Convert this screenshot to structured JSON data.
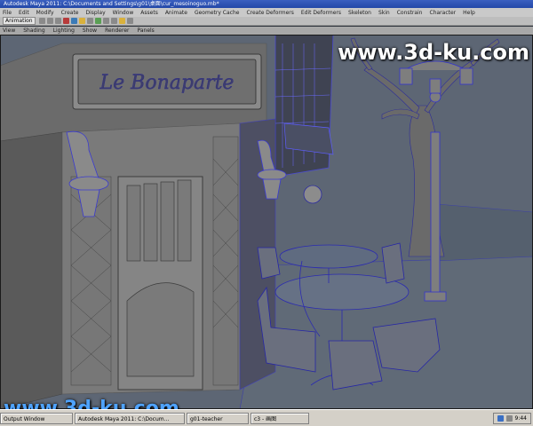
{
  "window": {
    "title": "Autodesk Maya 2011: C:\\Documents and Settings\\g01\\桌面\\cur_mesoinoguo.mb*"
  },
  "menu": [
    "File",
    "Edit",
    "Modify",
    "Create",
    "Display",
    "Window",
    "Assets",
    "Animate",
    "Geometry Cache",
    "Create Deformers",
    "Edit Deformers",
    "Skeleton",
    "Skin",
    "Constrain",
    "Character",
    "Help"
  ],
  "toolbar": {
    "mode": "Animation"
  },
  "panel_menu": [
    "View",
    "Shading",
    "Lighting",
    "Show",
    "Renderer",
    "Panels"
  ],
  "scene": {
    "sign_text": "Le Bonaparte"
  },
  "watermark": {
    "top": "www.3d-ku.com",
    "bottom": "www.3d-ku.com"
  },
  "taskbar": {
    "tasks": [
      "Output Window",
      "Autodesk Maya 2011: C:\\Docum...",
      "g01-teacher",
      "c3 - 画图"
    ],
    "clock": "9:44"
  }
}
